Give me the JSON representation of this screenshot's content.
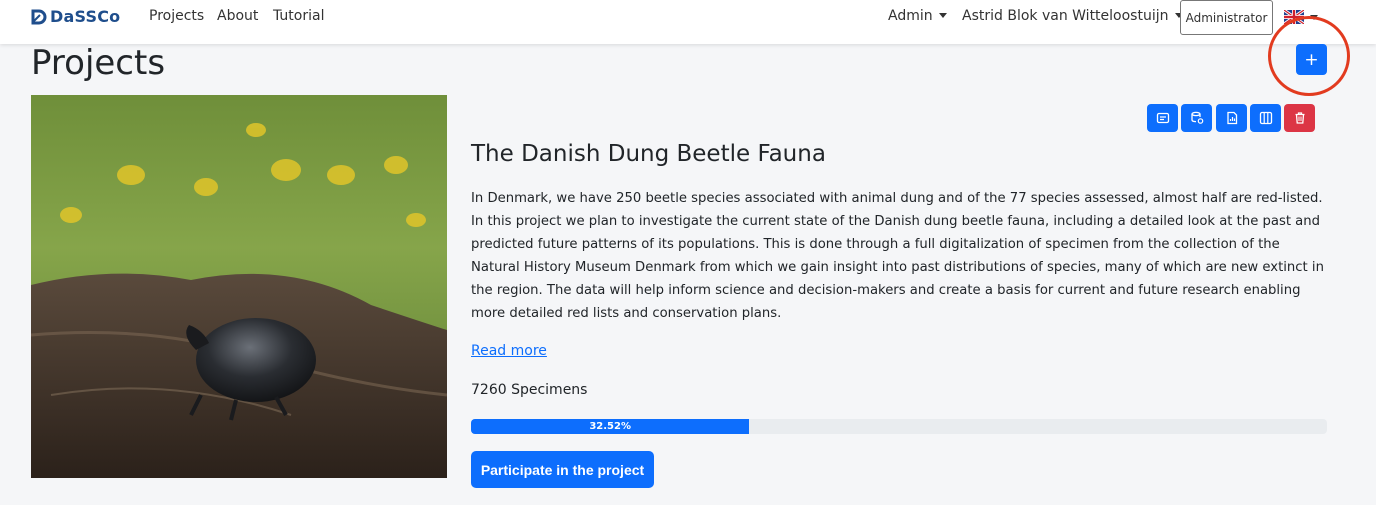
{
  "navbar": {
    "brand": "DaSSCo",
    "links": [
      "Projects",
      "About",
      "Tutorial"
    ],
    "admin_menu": "Admin",
    "user_menu": "Astrid Blok van Witteloostuijn",
    "role_badge": "Administrator",
    "language_icon": "uk-flag-icon"
  },
  "page": {
    "title": "Projects",
    "add_button_label": "+"
  },
  "project": {
    "title": "The Danish Dung Beetle Fauna",
    "description": "In Denmark, we have 250 beetle species associated with animal dung and of the 77 species assessed, almost half are red-listed. In this project we plan to investigate the current state of the Danish dung beetle fauna, including a detailed look at the past and predicted future patterns of its populations. This is done through a full digitalization of specimen from the collection of the Natural History Museum Denmark from which we gain insight into past distributions of species, many of which are new extinct in the region. The data will help inform science and decision-makers and create a basis for current and future research enabling more detailed red lists and conservation plans.",
    "read_more": "Read more",
    "specimens": "7260 Specimens",
    "progress_label": "32.52%",
    "progress_fraction": 0.3252,
    "participate_label": "Participate in the project",
    "image_icon": "dung-beetle-photo",
    "action_icons": [
      "edit-text-icon",
      "database-icon",
      "report-icon",
      "columns-icon",
      "trash-icon"
    ]
  },
  "colors": {
    "primary": "#0d6efd",
    "danger": "#dc3545",
    "annotation": "#e23b1f",
    "background": "#f5f6f8"
  }
}
